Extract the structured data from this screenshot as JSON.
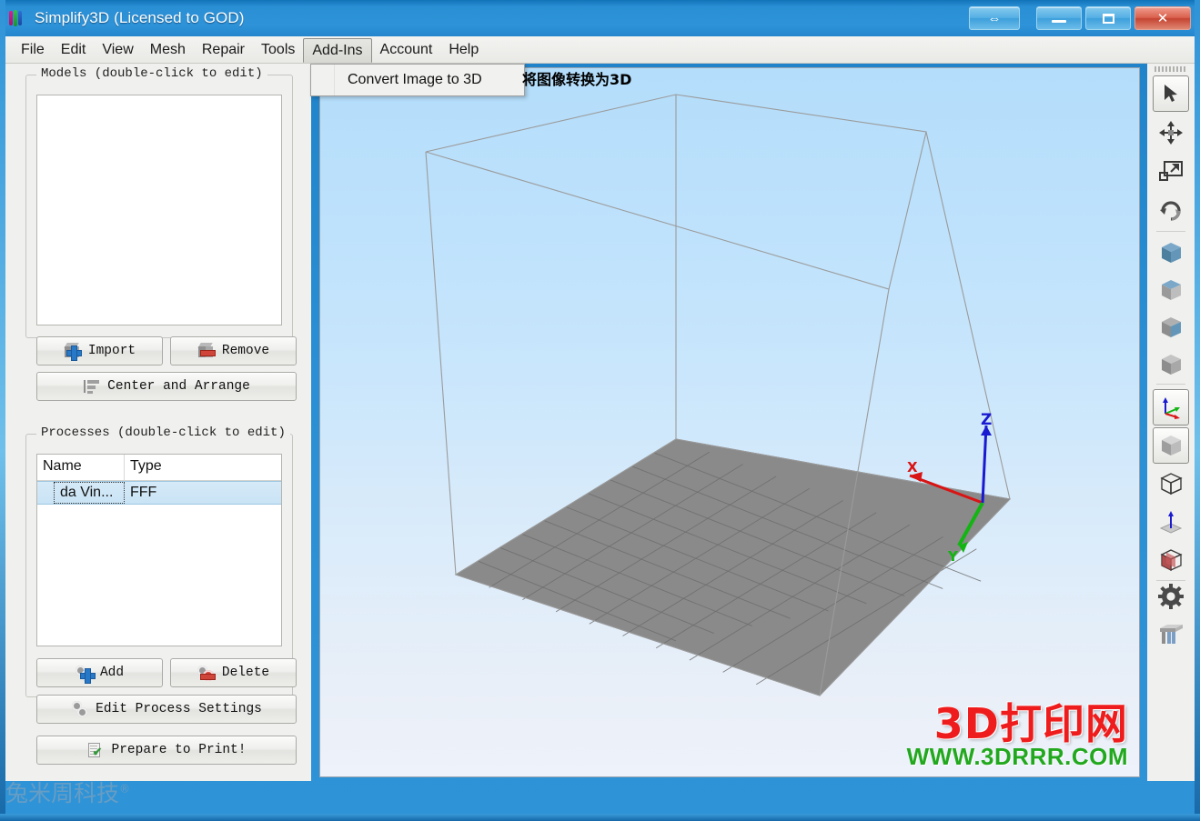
{
  "window": {
    "title": "Simplify3D (Licensed to GOD)",
    "app_icon": "simplify3d-logo-icon",
    "controls": {
      "help": "⇔",
      "minimize": "minimize-icon",
      "maximize": "maximize-icon",
      "close": "✕"
    }
  },
  "menubar": {
    "items": [
      {
        "label": "File",
        "active": false
      },
      {
        "label": "Edit",
        "active": false
      },
      {
        "label": "View",
        "active": false
      },
      {
        "label": "Mesh",
        "active": false
      },
      {
        "label": "Repair",
        "active": false
      },
      {
        "label": "Tools",
        "active": false
      },
      {
        "label": "Add-Ins",
        "active": true
      },
      {
        "label": "Account",
        "active": false
      },
      {
        "label": "Help",
        "active": false
      }
    ]
  },
  "dropdown": {
    "open_menu": "Add-Ins",
    "items": [
      {
        "label": "Convert Image to 3D"
      }
    ]
  },
  "annotation": {
    "chinese_hint": "将图像转换为3D"
  },
  "models_panel": {
    "legend": "Models (double-click to edit)",
    "list_items": [],
    "buttons": [
      {
        "label": "Import",
        "icon": "cube-plus-icon"
      },
      {
        "label": "Remove",
        "icon": "cube-minus-icon"
      },
      {
        "label": "Center and Arrange",
        "icon": "align-arrange-icon"
      }
    ]
  },
  "processes_panel": {
    "legend": "Processes (double-click to edit)",
    "columns": [
      "Name",
      "Type"
    ],
    "rows": [
      {
        "name": "da Vin...",
        "type": "FFF",
        "selected": true
      }
    ],
    "buttons": [
      {
        "label": "Add",
        "icon": "gear-plus-icon"
      },
      {
        "label": "Delete",
        "icon": "gear-minus-icon"
      },
      {
        "label": "Edit Process Settings",
        "icon": "gears-icon"
      },
      {
        "label": "Prepare to Print!",
        "icon": "document-check-icon"
      }
    ]
  },
  "viewport": {
    "axis_labels": {
      "x": "X",
      "y": "Y",
      "z": "Z"
    },
    "axis_colors": {
      "x": "#d81414",
      "y": "#12b512",
      "z": "#1a1ad0"
    },
    "build_plate_color": "#8a8a8a",
    "build_volume_edge_color": "#9b9b9b",
    "background_top": "#b3ddfb",
    "background_bottom": "#eef2fa",
    "grid_divisions": 10
  },
  "right_toolbar": {
    "tools": [
      {
        "name": "select-arrow-tool",
        "selected": true
      },
      {
        "name": "pan-move-tool",
        "selected": false
      },
      {
        "name": "scale-tool",
        "selected": false
      },
      {
        "name": "rotate-tool",
        "selected": false
      },
      {
        "name": "view-cube-front-tool",
        "selected": false
      },
      {
        "name": "view-cube-top-tool",
        "selected": false
      },
      {
        "name": "view-cube-side-tool",
        "selected": false
      },
      {
        "name": "view-cube-iso-tool",
        "selected": false
      },
      {
        "name": "axis-gizmo-toggle",
        "selected": true
      },
      {
        "name": "solid-view-tool",
        "selected": true
      },
      {
        "name": "wireframe-view-tool",
        "selected": false
      },
      {
        "name": "normals-view-tool",
        "selected": false
      },
      {
        "name": "cross-section-tool",
        "selected": false
      },
      {
        "name": "settings-gear-tool",
        "selected": false
      },
      {
        "name": "supports-tool",
        "selected": false
      }
    ]
  },
  "watermarks": {
    "brand_cn": "3D打印网",
    "brand_url": "WWW.3DRRR.COM",
    "left_faint": "兔米周科技"
  },
  "colors": {
    "titlebar_blue": "#2a8fd4",
    "close_red": "#c44431",
    "selection_blue": "#c9e3f5",
    "panel_gray": "#f0f0ee",
    "brand_red": "#ee1c1c",
    "brand_green": "#22a81e"
  }
}
